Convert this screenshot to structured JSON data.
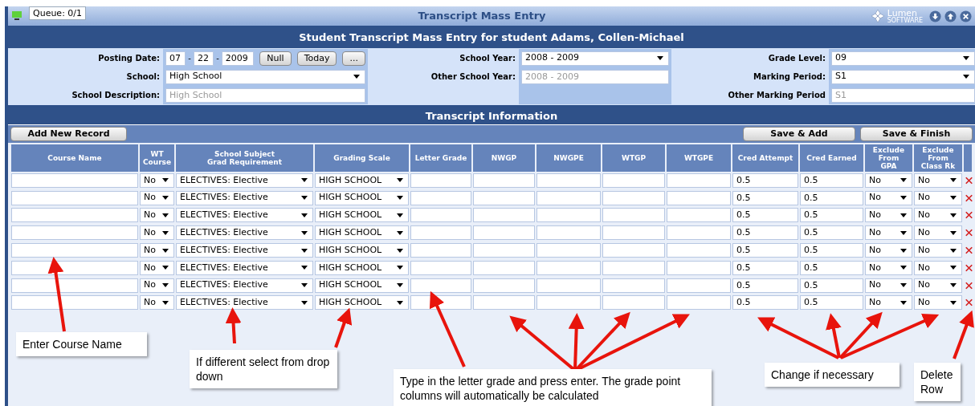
{
  "window": {
    "queue_tab": "Queue: 0/1",
    "title": "Transcript Mass Entry"
  },
  "logo": {
    "name": "Lumen",
    "tagline": "SOFTWARE"
  },
  "header": "Student Transcript Mass Entry for student Adams, Collen-Michael",
  "form": {
    "posting_date": {
      "label": "Posting Date:",
      "month": "07",
      "day": "22",
      "year": "2009",
      "separator": "-",
      "buttons": [
        "Null",
        "Today",
        "..."
      ]
    },
    "school": {
      "label": "School:",
      "value": "High School"
    },
    "school_description": {
      "label": "School Description:",
      "value": "High School",
      "disabled": true
    },
    "school_year": {
      "label": "School Year:",
      "value": "2008 - 2009"
    },
    "other_school_year": {
      "label": "Other School Year:",
      "value": "2008 - 2009",
      "disabled": true
    },
    "grade_level": {
      "label": "Grade Level:",
      "value": "09"
    },
    "marking_period": {
      "label": "Marking Period:",
      "value": "S1"
    },
    "other_marking_period": {
      "label": "Other Marking Period",
      "value": "S1",
      "disabled": true
    }
  },
  "section_title": "Transcript Information",
  "toolbar": {
    "left": [
      "Add New Record"
    ],
    "right": [
      "Save & Add",
      "Save & Finish"
    ]
  },
  "table": {
    "columns": [
      "Course Name",
      "WT\nCourse",
      "School Subject\nGrad Requirement",
      "Grading Scale",
      "Letter Grade",
      "NWGP",
      "NWGPE",
      "WTGP",
      "WTGPE",
      "Cred Attempt",
      "Cred Earned",
      "Exclude\nFrom\nGPA",
      "Exclude\nFrom\nClass Rk"
    ],
    "rows": [
      {
        "wt_course": "No",
        "subject": "ELECTIVES: Elective",
        "grading_scale": "HIGH SCHOOL",
        "cred_attempt": "0.5",
        "cred_earned": "0.5",
        "exclude_gpa": "No",
        "exclude_rank": "No"
      },
      {
        "wt_course": "No",
        "subject": "ELECTIVES: Elective",
        "grading_scale": "HIGH SCHOOL",
        "cred_attempt": "0.5",
        "cred_earned": "0.5",
        "exclude_gpa": "No",
        "exclude_rank": "No"
      },
      {
        "wt_course": "No",
        "subject": "ELECTIVES: Elective",
        "grading_scale": "HIGH SCHOOL",
        "cred_attempt": "0.5",
        "cred_earned": "0.5",
        "exclude_gpa": "No",
        "exclude_rank": "No"
      },
      {
        "wt_course": "No",
        "subject": "ELECTIVES: Elective",
        "grading_scale": "HIGH SCHOOL",
        "cred_attempt": "0.5",
        "cred_earned": "0.5",
        "exclude_gpa": "No",
        "exclude_rank": "No"
      },
      {
        "wt_course": "No",
        "subject": "ELECTIVES: Elective",
        "grading_scale": "HIGH SCHOOL",
        "cred_attempt": "0.5",
        "cred_earned": "0.5",
        "exclude_gpa": "No",
        "exclude_rank": "No"
      },
      {
        "wt_course": "No",
        "subject": "ELECTIVES: Elective",
        "grading_scale": "HIGH SCHOOL",
        "cred_attempt": "0.5",
        "cred_earned": "0.5",
        "exclude_gpa": "No",
        "exclude_rank": "No"
      },
      {
        "wt_course": "No",
        "subject": "ELECTIVES: Elective",
        "grading_scale": "HIGH SCHOOL",
        "cred_attempt": "0.5",
        "cred_earned": "0.5",
        "exclude_gpa": "No",
        "exclude_rank": "No"
      },
      {
        "wt_course": "No",
        "subject": "ELECTIVES: Elective",
        "grading_scale": "HIGH SCHOOL",
        "cred_attempt": "0.5",
        "cred_earned": "0.5",
        "exclude_gpa": "No",
        "exclude_rank": "No"
      }
    ]
  },
  "callouts": [
    {
      "text": "Enter Course Name"
    },
    {
      "text": "If different select from drop down"
    },
    {
      "text": "Type in the letter grade and press enter.  The grade point columns will automatically be calculated"
    },
    {
      "text": "Change if necessary"
    },
    {
      "text": "Delete Row"
    }
  ]
}
